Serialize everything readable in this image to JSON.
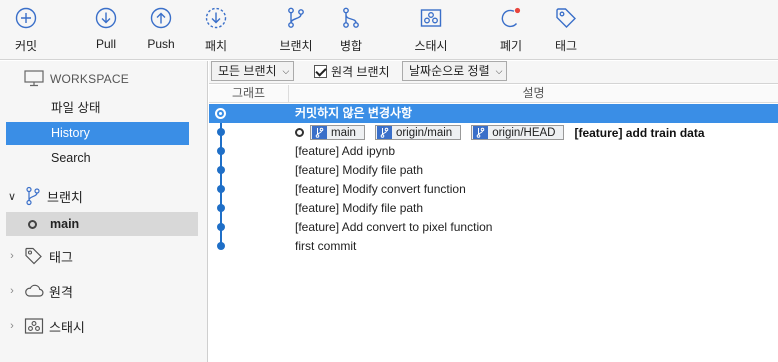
{
  "toolbar": {
    "commit": "커밋",
    "pull": "Pull",
    "push": "Push",
    "fetch": "패치",
    "branch": "브랜치",
    "merge": "병합",
    "stash": "스태시",
    "discard": "폐기",
    "tag": "태그"
  },
  "sidebar": {
    "workspace_header": "WORKSPACE",
    "items": [
      {
        "label": "파일 상태"
      },
      {
        "label": "History"
      },
      {
        "label": "Search"
      }
    ],
    "groups": {
      "branches": "브랜치",
      "tags": "태그",
      "remotes": "원격",
      "stashes": "스태시"
    },
    "current_branch": "main"
  },
  "filterbar": {
    "branch_filter": "모든 브랜치",
    "remote_branches_label": "원격 브랜치",
    "remote_branches_checked": true,
    "sort": "날짜순으로 정렬"
  },
  "columns": {
    "graph": "그래프",
    "description": "설명"
  },
  "commits": [
    {
      "message": "커밋하지 않은 변경사항",
      "selected": true
    },
    {
      "message": "[feature] add train data",
      "refs": [
        "main",
        "origin/main",
        "origin/HEAD"
      ]
    },
    {
      "message": "[feature] Add ipynb"
    },
    {
      "message": "[feature] Modify file path"
    },
    {
      "message": "[feature] Modify convert function"
    },
    {
      "message": "[feature] Modify file path"
    },
    {
      "message": "[feature] Add convert to pixel function"
    },
    {
      "message": "first commit"
    }
  ],
  "colors": {
    "accent": "#3a8ee6",
    "graph": "#1f6fc7",
    "discard_badge": "#e8453c"
  }
}
